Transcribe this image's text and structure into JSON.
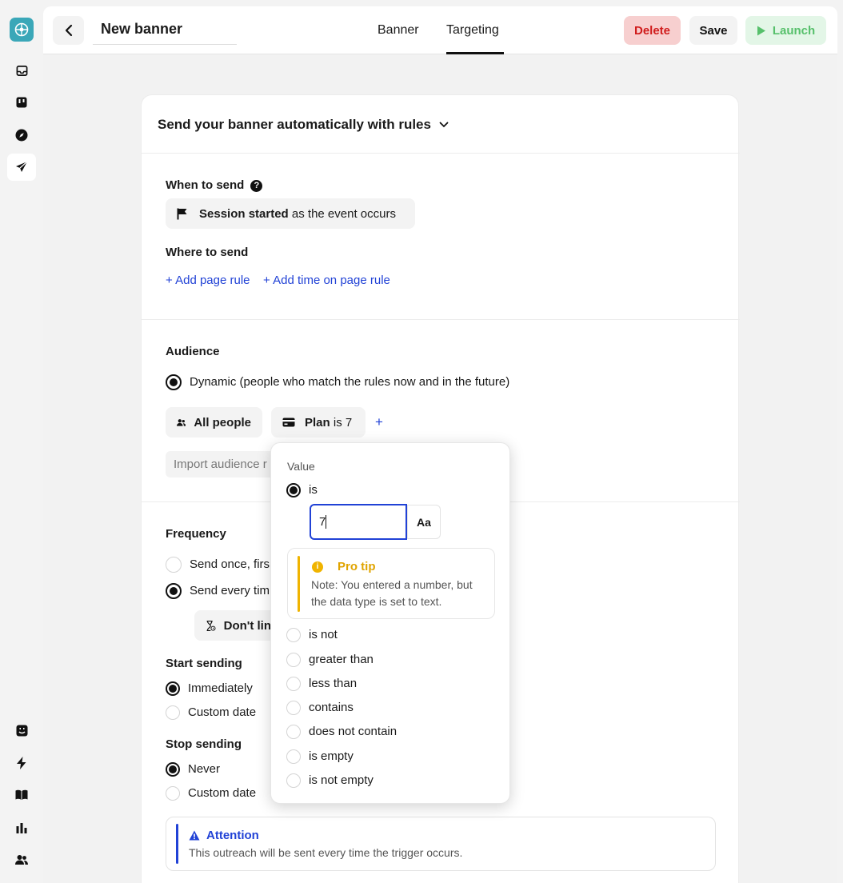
{
  "header": {
    "title": "New banner",
    "tabs": [
      "Banner",
      "Targeting"
    ],
    "actions": {
      "delete": "Delete",
      "save": "Save",
      "launch": "Launch"
    }
  },
  "rules": {
    "heading": "Send your banner automatically with rules",
    "when_label": "When to send",
    "when_event": "Session started",
    "when_suffix": "as the event occurs",
    "where_label": "Where to send",
    "add_page_rule": "+ Add page rule",
    "add_time_rule": "+ Add time on page rule"
  },
  "audience": {
    "label": "Audience",
    "dynamic": "Dynamic (people who match the rules now and in the future)",
    "all_people": "All people",
    "plan_attr": "Plan",
    "plan_op": "is 7",
    "add": "+",
    "import": "Import audience r"
  },
  "frequency": {
    "label": "Frequency",
    "once": "Send once, firs",
    "every": "Send every tim",
    "dont_limit": "Don't lin"
  },
  "start": {
    "label": "Start sending",
    "immediately": "Immediately",
    "custom": "Custom date"
  },
  "stop": {
    "label": "Stop sending",
    "never": "Never",
    "custom": "Custom date"
  },
  "attention": {
    "title": "Attention",
    "text": "This outreach will be sent every time the trigger occurs."
  },
  "popover": {
    "value_label": "Value",
    "is": "is",
    "input_value": "7",
    "type_toggle": "Aa",
    "tip_title": "Pro tip",
    "tip_text": "Note: You entered a number, but the data type is set to text.",
    "options": [
      "is not",
      "greater than",
      "less than",
      "contains",
      "does not contain",
      "is empty",
      "is not empty"
    ]
  }
}
